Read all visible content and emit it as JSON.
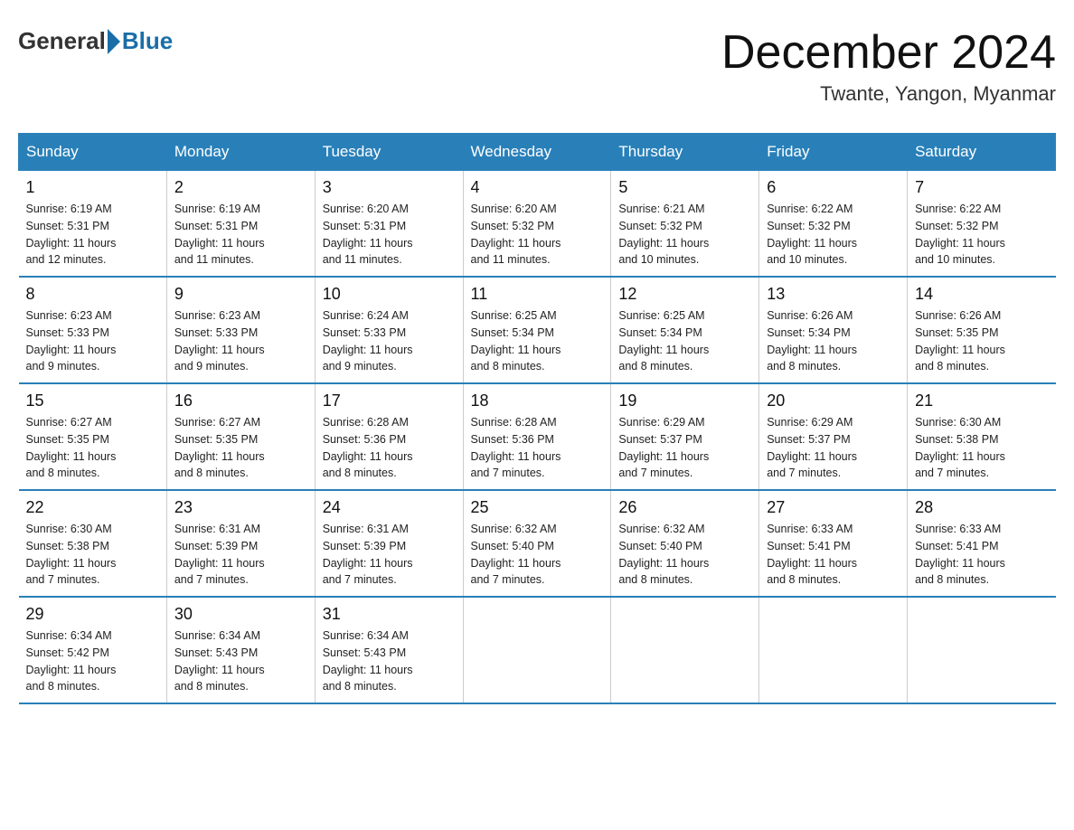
{
  "header": {
    "logo_text_general": "General",
    "logo_text_blue": "Blue",
    "month_title": "December 2024",
    "location": "Twante, Yangon, Myanmar"
  },
  "days_of_week": [
    "Sunday",
    "Monday",
    "Tuesday",
    "Wednesday",
    "Thursday",
    "Friday",
    "Saturday"
  ],
  "weeks": [
    [
      {
        "day": "1",
        "sunrise": "6:19 AM",
        "sunset": "5:31 PM",
        "daylight": "11 hours and 12 minutes."
      },
      {
        "day": "2",
        "sunrise": "6:19 AM",
        "sunset": "5:31 PM",
        "daylight": "11 hours and 11 minutes."
      },
      {
        "day": "3",
        "sunrise": "6:20 AM",
        "sunset": "5:31 PM",
        "daylight": "11 hours and 11 minutes."
      },
      {
        "day": "4",
        "sunrise": "6:20 AM",
        "sunset": "5:32 PM",
        "daylight": "11 hours and 11 minutes."
      },
      {
        "day": "5",
        "sunrise": "6:21 AM",
        "sunset": "5:32 PM",
        "daylight": "11 hours and 10 minutes."
      },
      {
        "day": "6",
        "sunrise": "6:22 AM",
        "sunset": "5:32 PM",
        "daylight": "11 hours and 10 minutes."
      },
      {
        "day": "7",
        "sunrise": "6:22 AM",
        "sunset": "5:32 PM",
        "daylight": "11 hours and 10 minutes."
      }
    ],
    [
      {
        "day": "8",
        "sunrise": "6:23 AM",
        "sunset": "5:33 PM",
        "daylight": "11 hours and 9 minutes."
      },
      {
        "day": "9",
        "sunrise": "6:23 AM",
        "sunset": "5:33 PM",
        "daylight": "11 hours and 9 minutes."
      },
      {
        "day": "10",
        "sunrise": "6:24 AM",
        "sunset": "5:33 PM",
        "daylight": "11 hours and 9 minutes."
      },
      {
        "day": "11",
        "sunrise": "6:25 AM",
        "sunset": "5:34 PM",
        "daylight": "11 hours and 8 minutes."
      },
      {
        "day": "12",
        "sunrise": "6:25 AM",
        "sunset": "5:34 PM",
        "daylight": "11 hours and 8 minutes."
      },
      {
        "day": "13",
        "sunrise": "6:26 AM",
        "sunset": "5:34 PM",
        "daylight": "11 hours and 8 minutes."
      },
      {
        "day": "14",
        "sunrise": "6:26 AM",
        "sunset": "5:35 PM",
        "daylight": "11 hours and 8 minutes."
      }
    ],
    [
      {
        "day": "15",
        "sunrise": "6:27 AM",
        "sunset": "5:35 PM",
        "daylight": "11 hours and 8 minutes."
      },
      {
        "day": "16",
        "sunrise": "6:27 AM",
        "sunset": "5:35 PM",
        "daylight": "11 hours and 8 minutes."
      },
      {
        "day": "17",
        "sunrise": "6:28 AM",
        "sunset": "5:36 PM",
        "daylight": "11 hours and 8 minutes."
      },
      {
        "day": "18",
        "sunrise": "6:28 AM",
        "sunset": "5:36 PM",
        "daylight": "11 hours and 7 minutes."
      },
      {
        "day": "19",
        "sunrise": "6:29 AM",
        "sunset": "5:37 PM",
        "daylight": "11 hours and 7 minutes."
      },
      {
        "day": "20",
        "sunrise": "6:29 AM",
        "sunset": "5:37 PM",
        "daylight": "11 hours and 7 minutes."
      },
      {
        "day": "21",
        "sunrise": "6:30 AM",
        "sunset": "5:38 PM",
        "daylight": "11 hours and 7 minutes."
      }
    ],
    [
      {
        "day": "22",
        "sunrise": "6:30 AM",
        "sunset": "5:38 PM",
        "daylight": "11 hours and 7 minutes."
      },
      {
        "day": "23",
        "sunrise": "6:31 AM",
        "sunset": "5:39 PM",
        "daylight": "11 hours and 7 minutes."
      },
      {
        "day": "24",
        "sunrise": "6:31 AM",
        "sunset": "5:39 PM",
        "daylight": "11 hours and 7 minutes."
      },
      {
        "day": "25",
        "sunrise": "6:32 AM",
        "sunset": "5:40 PM",
        "daylight": "11 hours and 7 minutes."
      },
      {
        "day": "26",
        "sunrise": "6:32 AM",
        "sunset": "5:40 PM",
        "daylight": "11 hours and 8 minutes."
      },
      {
        "day": "27",
        "sunrise": "6:33 AM",
        "sunset": "5:41 PM",
        "daylight": "11 hours and 8 minutes."
      },
      {
        "day": "28",
        "sunrise": "6:33 AM",
        "sunset": "5:41 PM",
        "daylight": "11 hours and 8 minutes."
      }
    ],
    [
      {
        "day": "29",
        "sunrise": "6:34 AM",
        "sunset": "5:42 PM",
        "daylight": "11 hours and 8 minutes."
      },
      {
        "day": "30",
        "sunrise": "6:34 AM",
        "sunset": "5:43 PM",
        "daylight": "11 hours and 8 minutes."
      },
      {
        "day": "31",
        "sunrise": "6:34 AM",
        "sunset": "5:43 PM",
        "daylight": "11 hours and 8 minutes."
      },
      null,
      null,
      null,
      null
    ]
  ],
  "labels": {
    "sunrise": "Sunrise:",
    "sunset": "Sunset:",
    "daylight": "Daylight:"
  }
}
